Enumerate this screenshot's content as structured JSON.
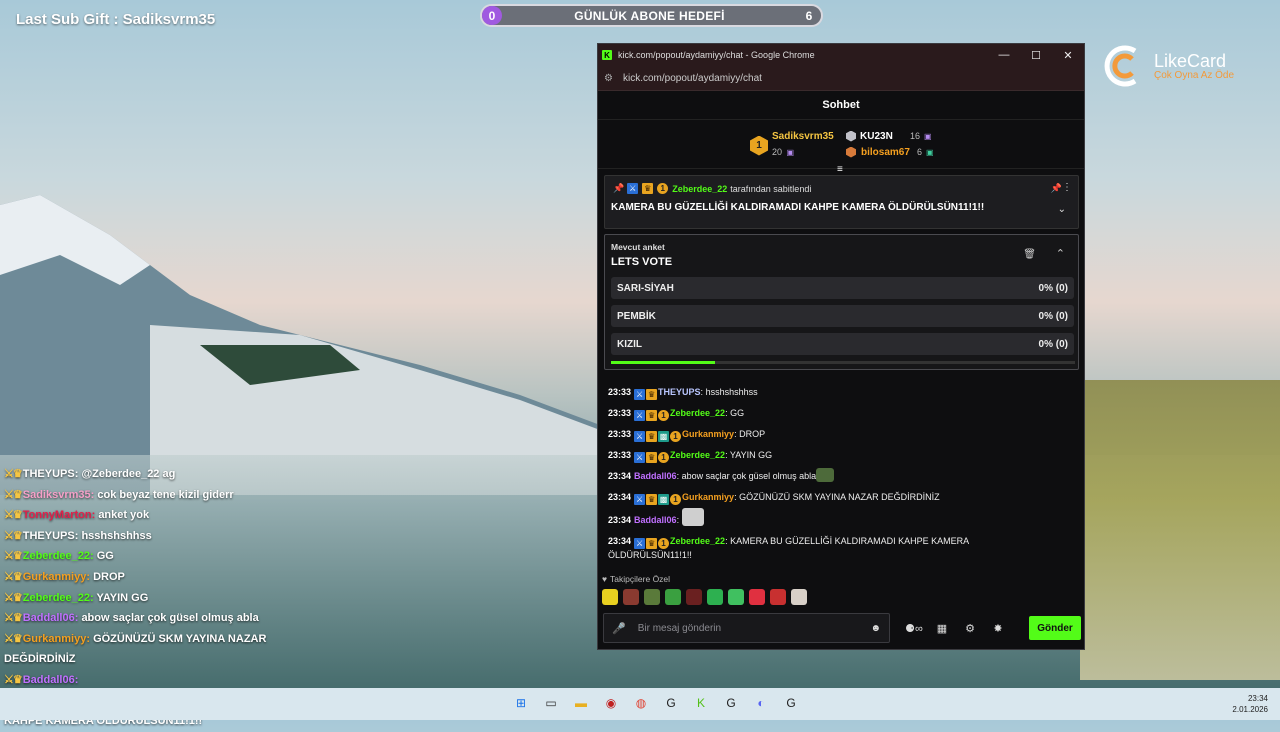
{
  "overlay": {
    "last_sub": "Last Sub Gift : Sadiksvrm35",
    "goal": {
      "start": "0",
      "title": "GÜNLÜK ABONE HEDEFİ",
      "end": "6"
    },
    "brand": {
      "name": "LikeCard",
      "tagline": "Çok Oyna  Az Öde"
    },
    "chat": [
      {
        "user": "THEYUPS",
        "color": "#ffffff",
        "text": "@Zeberdee_22 ag"
      },
      {
        "user": "Sadiksvrm35",
        "color": "#f5a0c8",
        "text": "cok beyaz tene kizil giderr"
      },
      {
        "user": "TonnyMarton",
        "color": "#e0204a",
        "text": "anket yok"
      },
      {
        "user": "THEYUPS",
        "color": "#ffffff",
        "text": "hsshshshhss"
      },
      {
        "user": "Zeberdee_22",
        "color": "#53fc18",
        "text": "GG"
      },
      {
        "user": "Gurkanmiyy",
        "color": "#f5a020",
        "text": "DROP"
      },
      {
        "user": "Zeberdee_22",
        "color": "#53fc18",
        "text": "YAYIN GG"
      },
      {
        "user": "Baddall06",
        "color": "#c070ff",
        "text": "abow saçlar çok güsel olmuş abla"
      },
      {
        "user": "Gurkanmiyy",
        "color": "#f5a020",
        "text": "GÖZÜNÜZÜ SKM YAYINA NAZAR"
      },
      {
        "user": "",
        "color": "#ffffff",
        "text": "DEĞDİRDİNİZ"
      },
      {
        "user": "Baddall06",
        "color": "#c070ff",
        "text": ""
      },
      {
        "user": "Zeberdee_22",
        "color": "#53fc18",
        "text": "KAMERA BU GÜZELLİĞİ KALDIRAMADI"
      },
      {
        "user": "",
        "color": "#ffffff",
        "text": "KAHPE KAMERA ÖLDÜRÜLSÜN11!1!!"
      }
    ]
  },
  "window": {
    "title": "kick.com/popout/aydamiyy/chat - Google Chrome",
    "url": "kick.com/popout/aydamiyy/chat",
    "header": "Sohbet",
    "leaderboard": [
      {
        "rank": "1",
        "name": "Sadiksvrm35",
        "count": "20"
      },
      {
        "name": "KU23N",
        "count": "16"
      },
      {
        "name": "bilosam67",
        "count": "6"
      }
    ],
    "pinned": {
      "by_user": "Zeberdee_22",
      "by_suffix": "tarafından sabitlendi",
      "message": "KAMERA BU GÜZELLİĞİ KALDIRAMADI KAHPE KAMERA ÖLDÜRÜLSÜN11!1!!"
    },
    "poll": {
      "label": "Mevcut anket",
      "question": "LETS VOTE",
      "time_remaining_fraction": 0.225,
      "options": [
        {
          "label": "SARI-SİYAH",
          "result": "0% (0)"
        },
        {
          "label": "PEMBİK",
          "result": "0% (0)"
        },
        {
          "label": "KIZIL",
          "result": "0% (0)"
        }
      ]
    },
    "messages": [
      {
        "time": "23:33",
        "user": "THEYUPS",
        "color": "#b9c6ff",
        "text": "hsshshshhss"
      },
      {
        "time": "23:33",
        "user": "Zeberdee_22",
        "color": "#53fc18",
        "text": "GG"
      },
      {
        "time": "23:33",
        "user": "Gurkanmiyy",
        "color": "#f5a020",
        "text": "DROP"
      },
      {
        "time": "23:33",
        "user": "Zeberdee_22",
        "color": "#53fc18",
        "text": "YAYIN GG"
      },
      {
        "time": "23:34",
        "user": "Baddall06",
        "color": "#c070ff",
        "text": "abow saçlar çok güsel olmuş abla"
      },
      {
        "time": "23:34",
        "user": "Gurkanmiyy",
        "color": "#f5a020",
        "text": "GÖZÜNÜZÜ SKM YAYINA NAZAR DEĞDİRDİNİZ"
      },
      {
        "time": "23:34",
        "user": "Baddall06",
        "color": "#c070ff",
        "text": ""
      },
      {
        "time": "23:34",
        "user": "Zeberdee_22",
        "color": "#53fc18",
        "text": "KAMERA BU GÜZELLİĞİ KALDIRAMADI KAHPE KAMERA ÖLDÜRÜLSÜN11!1!!"
      }
    ],
    "emotes_label": "Takipçilere Özel",
    "input_placeholder": "Bir mesaj gönderin",
    "send_label": "Gönder"
  },
  "taskbar": {
    "time": "23:34",
    "date": "2.01.2026"
  }
}
